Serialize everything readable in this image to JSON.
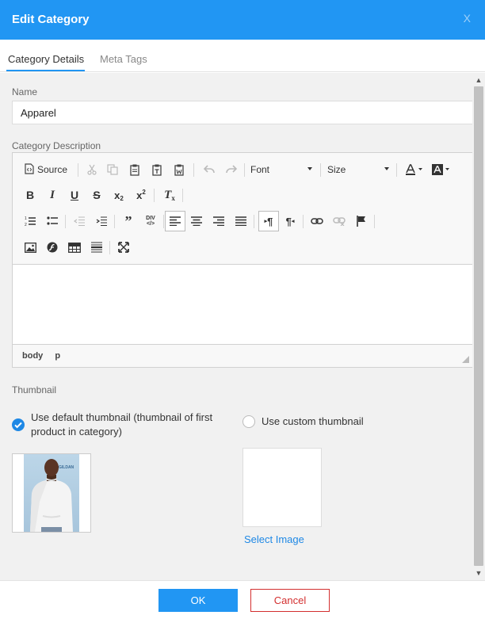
{
  "dialog": {
    "title": "Edit Category",
    "close_label": "X"
  },
  "tabs": [
    {
      "label": "Category Details",
      "active": true
    },
    {
      "label": "Meta Tags",
      "active": false
    }
  ],
  "form": {
    "name_label": "Name",
    "name_value": "Apparel",
    "description_label": "Category Description",
    "thumbnail_label": "Thumbnail"
  },
  "editor": {
    "source_label": "Source",
    "font_label": "Font",
    "size_label": "Size",
    "path": [
      "body",
      "p"
    ]
  },
  "thumbnail": {
    "default_option": "Use default thumbnail (thumbnail of first product in category)",
    "custom_option": "Use custom thumbnail",
    "select_image_label": "Select Image",
    "default_selected": true,
    "image_brand": "GILDAN"
  },
  "footer": {
    "ok_label": "OK",
    "cancel_label": "Cancel"
  },
  "colors": {
    "primary": "#2196f3",
    "danger": "#d32f2f"
  }
}
